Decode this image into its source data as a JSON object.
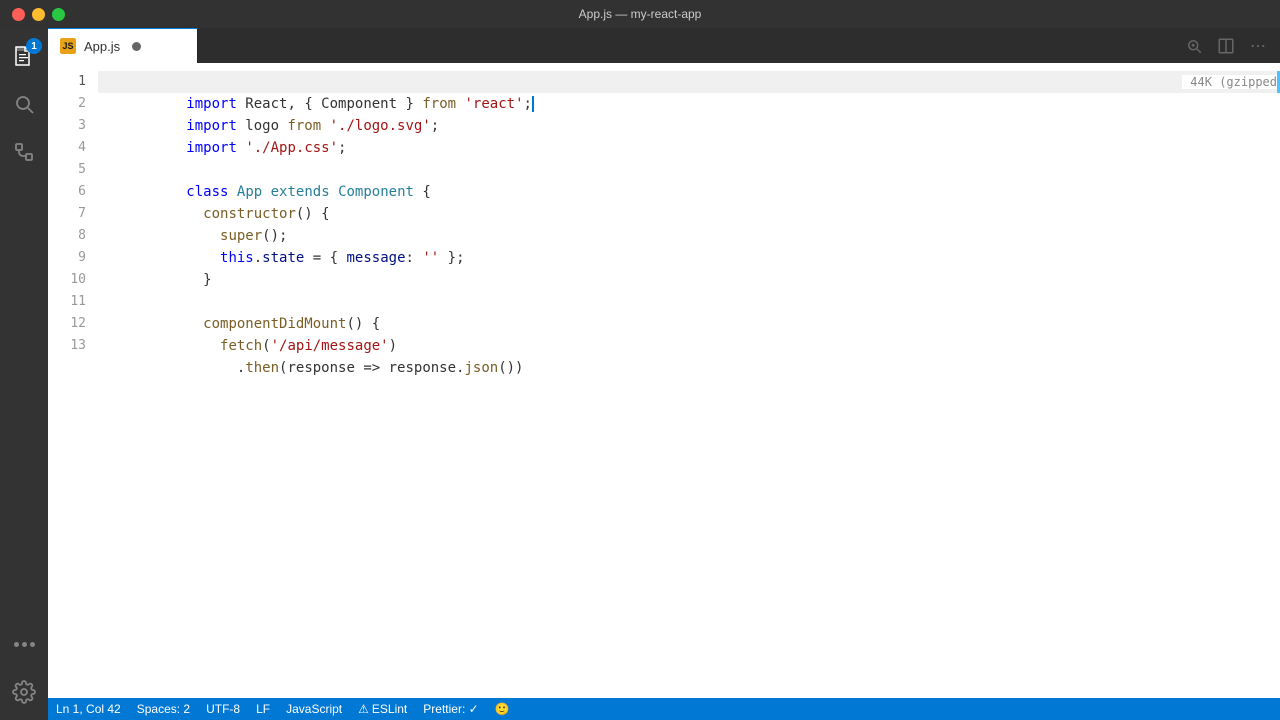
{
  "titleBar": {
    "title": "App.js — my-react-app"
  },
  "tab": {
    "filename": "App.js",
    "modified": true,
    "sizeHint": "44K (gzipped"
  },
  "statusBar": {
    "position": "Ln 1, Col 42",
    "spaces": "Spaces: 2",
    "encoding": "UTF-8",
    "lineEnding": "LF",
    "language": "JavaScript",
    "eslint": "ESLint",
    "prettier": "Prettier: ✓"
  },
  "code": {
    "lines": [
      {
        "num": 1,
        "content": "import React, { Component } from 'react';"
      },
      {
        "num": 2,
        "content": "import logo from './logo.svg';"
      },
      {
        "num": 3,
        "content": "import './App.css';"
      },
      {
        "num": 4,
        "content": ""
      },
      {
        "num": 5,
        "content": "class App extends Component {"
      },
      {
        "num": 6,
        "content": "  constructor() {"
      },
      {
        "num": 7,
        "content": "    super();"
      },
      {
        "num": 8,
        "content": "    this.state = { message: '' };"
      },
      {
        "num": 9,
        "content": "  }"
      },
      {
        "num": 10,
        "content": ""
      },
      {
        "num": 11,
        "content": "  componentDidMount() {"
      },
      {
        "num": 12,
        "content": "    fetch('/api/message')"
      },
      {
        "num": 13,
        "content": "      .then(response => response.json())"
      }
    ]
  },
  "activityBar": {
    "badge": "1",
    "icons": [
      "files",
      "search",
      "source-control",
      "extensions",
      "settings"
    ]
  }
}
